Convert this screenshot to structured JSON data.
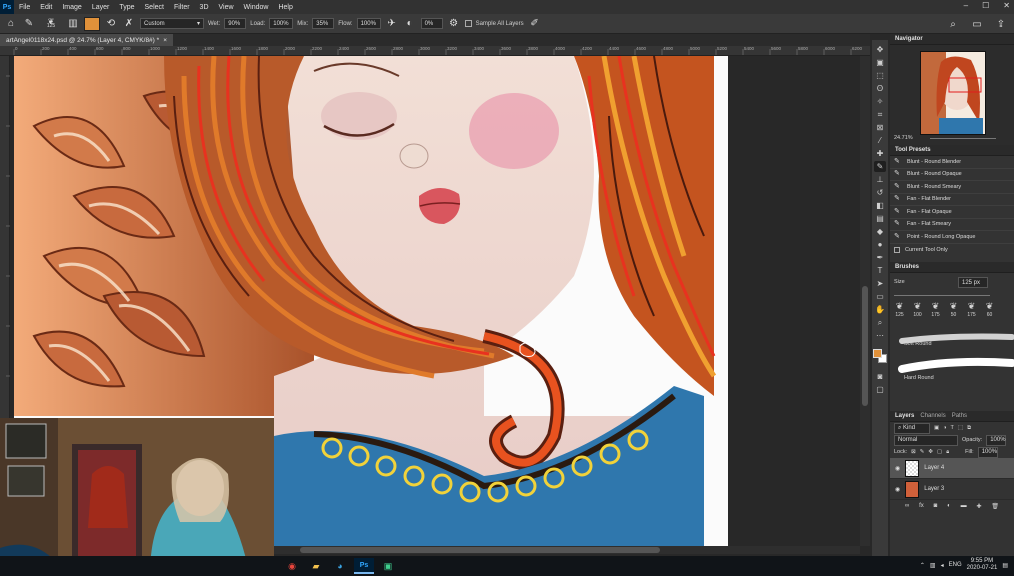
{
  "menu": {
    "logo": "Ps",
    "items": [
      "File",
      "Edit",
      "Image",
      "Layer",
      "Type",
      "Select",
      "Filter",
      "3D",
      "View",
      "Window",
      "Help"
    ],
    "window_controls": [
      "–",
      "☐",
      "✕"
    ]
  },
  "options_bar": {
    "brush_size": "125",
    "mode": "Custom",
    "wet_label": "Wet:",
    "wet_value": "90%",
    "load_label": "Load:",
    "load_value": "100%",
    "mix_label": "Mix:",
    "mix_value": "35%",
    "flow_label": "Flow:",
    "flow_value": "100%",
    "angle_value": "0%",
    "sample_all_layers": "Sample All Layers",
    "foreground_color": "#e0913a"
  },
  "document": {
    "tab_title": "artAngel0118x24.psd @ 24.7% (Layer 4, CMYK/8#) *",
    "close": "×"
  },
  "rulers": {
    "ticks": [
      "0",
      "200",
      "400",
      "600",
      "800",
      "1000",
      "1200",
      "1400",
      "1600",
      "1800",
      "2000",
      "2200",
      "2400",
      "2600",
      "2800",
      "3000",
      "3200",
      "3400",
      "3600",
      "3800",
      "4000",
      "4200",
      "4400",
      "4600",
      "4800",
      "5000",
      "5200",
      "5400",
      "5600",
      "5800",
      "6000",
      "6200"
    ]
  },
  "panels": {
    "navigator": {
      "title": "Navigator",
      "zoom": "24.71%"
    },
    "tool_presets": {
      "title": "Tool Presets",
      "items": [
        "Blunt - Round Blender",
        "Blunt - Round Opaque",
        "Blunt - Round Smeary",
        "Fan - Flat Blender",
        "Fan - Flat Opaque",
        "Fan - Flat Smeary",
        "Point - Round Long Opaque"
      ],
      "current_tool_only": "Current Tool Only"
    },
    "brushes": {
      "title": "Brushes",
      "size_label": "Size",
      "size_value": "125 px",
      "tip_sizes": [
        "125",
        "100",
        "175",
        "50",
        "175",
        "60"
      ],
      "soft_label": "Soft Round",
      "hard_label": "Hard Round"
    },
    "layers": {
      "tabs": [
        "Layers",
        "Channels",
        "Paths"
      ],
      "kind": "Kind",
      "blend_mode": "Normal",
      "opacity_label": "Opacity:",
      "opacity_value": "100%",
      "lock_label": "Lock:",
      "fill_label": "Fill:",
      "fill_value": "100%",
      "rows": [
        {
          "name": "Layer 4",
          "selected": true
        },
        {
          "name": "Layer 3",
          "selected": false
        }
      ]
    }
  },
  "taskbar": {
    "time": "9:55 PM",
    "date": "2020-07-21",
    "lang": "ENG"
  }
}
